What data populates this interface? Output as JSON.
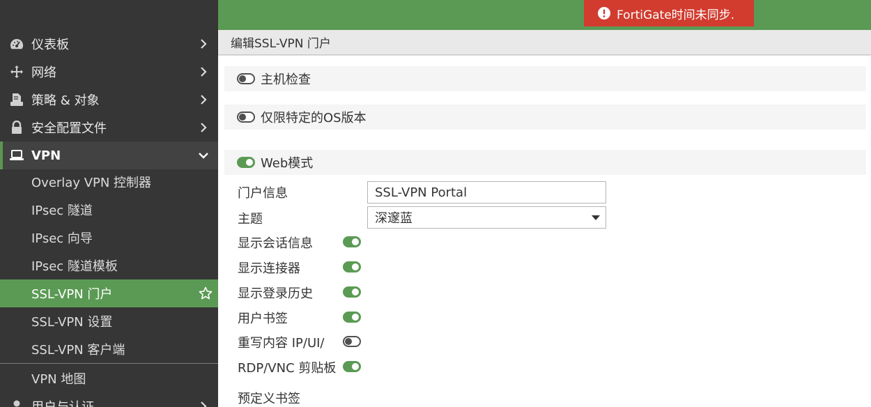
{
  "sidebar": {
    "items": [
      {
        "label": "仪表板",
        "icon": "dashboard-icon"
      },
      {
        "label": "网络",
        "icon": "network-move-icon"
      },
      {
        "label": "策略 & 对象",
        "icon": "policy-document-icon"
      },
      {
        "label": "安全配置文件",
        "icon": "lock-icon"
      }
    ],
    "vpn": {
      "label": "VPN",
      "icon": "laptop-icon"
    },
    "vpn_sub": [
      {
        "label": "Overlay VPN 控制器"
      },
      {
        "label": "IPsec 隧道"
      },
      {
        "label": "IPsec 向导"
      },
      {
        "label": "IPsec 隧道模板"
      },
      {
        "label": "SSL-VPN 门户",
        "active": true
      },
      {
        "label": "SSL-VPN 设置"
      },
      {
        "label": "SSL-VPN 客户端"
      },
      {
        "label": "VPN 地图"
      }
    ],
    "next_item": {
      "label": "用户与认证",
      "icon": "user-icon"
    }
  },
  "alert": {
    "text": "FortiGate时间未同步.",
    "color": "#d13c2f"
  },
  "page": {
    "title": "编辑SSL-VPN 门户"
  },
  "sections": {
    "host_check": {
      "label": "主机检查",
      "enabled": false
    },
    "os_limit": {
      "label": "仅限特定的OS版本",
      "enabled": false
    },
    "web_mode": {
      "label": "Web模式",
      "enabled": true
    }
  },
  "form": {
    "portal_message": {
      "label": "门户信息",
      "value": "SSL-VPN Portal"
    },
    "theme": {
      "label": "主题",
      "value": "深邃蓝"
    },
    "toggles": [
      {
        "label": "显示会话信息",
        "enabled": true
      },
      {
        "label": "显示连接器",
        "enabled": true
      },
      {
        "label": "显示登录历史",
        "enabled": true
      },
      {
        "label": "用户书签",
        "enabled": true
      },
      {
        "label": "重写内容 IP/UI/",
        "enabled": false
      },
      {
        "label": "RDP/VNC 剪贴板",
        "enabled": true
      }
    ],
    "predefined_bookmarks": {
      "label": "预定义书签"
    }
  },
  "colors": {
    "accent": "#5b9a54",
    "sidebar": "#363636",
    "alert": "#d13c2f"
  }
}
